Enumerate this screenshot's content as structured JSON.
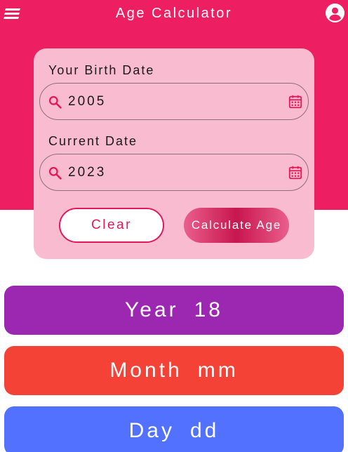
{
  "app": {
    "title": "Age Calculator"
  },
  "form": {
    "birth_label": "Your Birth Date",
    "birth_value": "2005",
    "current_label": "Current Date",
    "current_value": "2023",
    "clear_label": "Clear",
    "calculate_label": "Calculate Age"
  },
  "results": {
    "year_label": "Year",
    "year_value": "18",
    "month_label": "Month",
    "month_value": "mm",
    "day_label": "Day",
    "day_value": "dd"
  },
  "icons": {
    "menu": "menu-icon",
    "profile": "account-circle-icon",
    "search": "search-icon",
    "calendar": "calendar-icon"
  },
  "colors": {
    "header": "#ee1e63",
    "card": "#f9bbd0",
    "accent": "#e31a5a",
    "year": "#9c27b0",
    "month": "#f44336",
    "day": "#5271ff"
  }
}
